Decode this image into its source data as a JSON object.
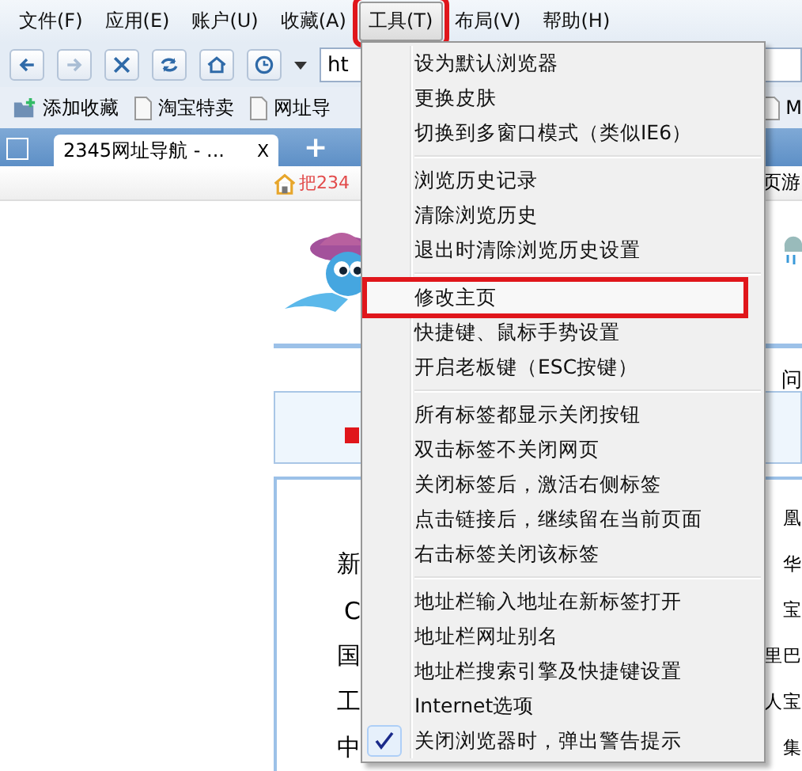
{
  "menubar": [
    {
      "label": "文件(F)",
      "selected": false,
      "annotated": false
    },
    {
      "label": "应用(E)",
      "selected": false,
      "annotated": false
    },
    {
      "label": "账户(U)",
      "selected": false,
      "annotated": false
    },
    {
      "label": "收藏(A)",
      "selected": false,
      "annotated": false
    },
    {
      "label": "工具(T)",
      "selected": true,
      "annotated": true
    },
    {
      "label": "布局(V)",
      "selected": false,
      "annotated": false
    },
    {
      "label": "帮助(H)",
      "selected": false,
      "annotated": false
    }
  ],
  "toolbar": {
    "buttons": [
      {
        "kind": "back",
        "disabled": false
      },
      {
        "kind": "forward",
        "disabled": true
      },
      {
        "kind": "stop",
        "disabled": false
      },
      {
        "kind": "refresh",
        "disabled": false
      },
      {
        "kind": "home",
        "disabled": false
      },
      {
        "kind": "history",
        "disabled": false
      }
    ],
    "address": "ht"
  },
  "bookmarks": [
    {
      "kind": "add",
      "label": "添加收藏"
    },
    {
      "kind": "page",
      "label": "淘宝特卖"
    },
    {
      "kind": "page",
      "label": "网址导"
    },
    {
      "kind": "page",
      "label": "M"
    }
  ],
  "tabs": [
    {
      "title": "2345网址导航 - ...",
      "close": "X",
      "selected": true
    }
  ],
  "new_tab": "+",
  "page": {
    "home_link": "把234",
    "right_top": "页游",
    "right_mid": "问",
    "rows": [
      {
        "left": "",
        "right": "凰"
      },
      {
        "left": "新",
        "right": "华"
      },
      {
        "left": "C",
        "right": "宝"
      },
      {
        "left": "国",
        "right": "里巴"
      },
      {
        "left": "工",
        "right": "人宝"
      },
      {
        "left": "中",
        "right": "集"
      }
    ]
  },
  "menu": {
    "groups": [
      [
        {
          "label": "设为默认浏览器",
          "checked": false,
          "annotated": false
        },
        {
          "label": "更换皮肤",
          "checked": false,
          "annotated": false
        },
        {
          "label": "切换到多窗口模式（类似IE6）",
          "checked": false,
          "annotated": false
        }
      ],
      [
        {
          "label": "浏览历史记录",
          "checked": false,
          "annotated": false
        },
        {
          "label": "清除浏览历史",
          "checked": false,
          "annotated": false
        },
        {
          "label": "退出时清除浏览历史设置",
          "checked": false,
          "annotated": false
        }
      ],
      [
        {
          "label": "修改主页",
          "checked": false,
          "annotated": true
        },
        {
          "label": "快捷键、鼠标手势设置",
          "checked": false,
          "annotated": false
        },
        {
          "label": "开启老板键（ESC按键）",
          "checked": false,
          "annotated": false
        }
      ],
      [
        {
          "label": "所有标签都显示关闭按钮",
          "checked": false,
          "annotated": false
        },
        {
          "label": "双击标签不关闭网页",
          "checked": false,
          "annotated": false
        },
        {
          "label": "关闭标签后，激活右侧标签",
          "checked": false,
          "annotated": false
        },
        {
          "label": "点击链接后，继续留在当前页面",
          "checked": false,
          "annotated": false
        },
        {
          "label": "右击标签关闭该标签",
          "checked": false,
          "annotated": false
        }
      ],
      [
        {
          "label": "地址栏输入地址在新标签打开",
          "checked": false,
          "annotated": false
        },
        {
          "label": "地址栏网址别名",
          "checked": false,
          "annotated": false
        },
        {
          "label": "地址栏搜索引擎及快捷键设置",
          "checked": false,
          "annotated": false
        },
        {
          "label": "Internet选项",
          "checked": false,
          "annotated": false
        },
        {
          "label": "关闭浏览器时，弹出警告提示",
          "checked": true,
          "annotated": false
        }
      ]
    ]
  }
}
